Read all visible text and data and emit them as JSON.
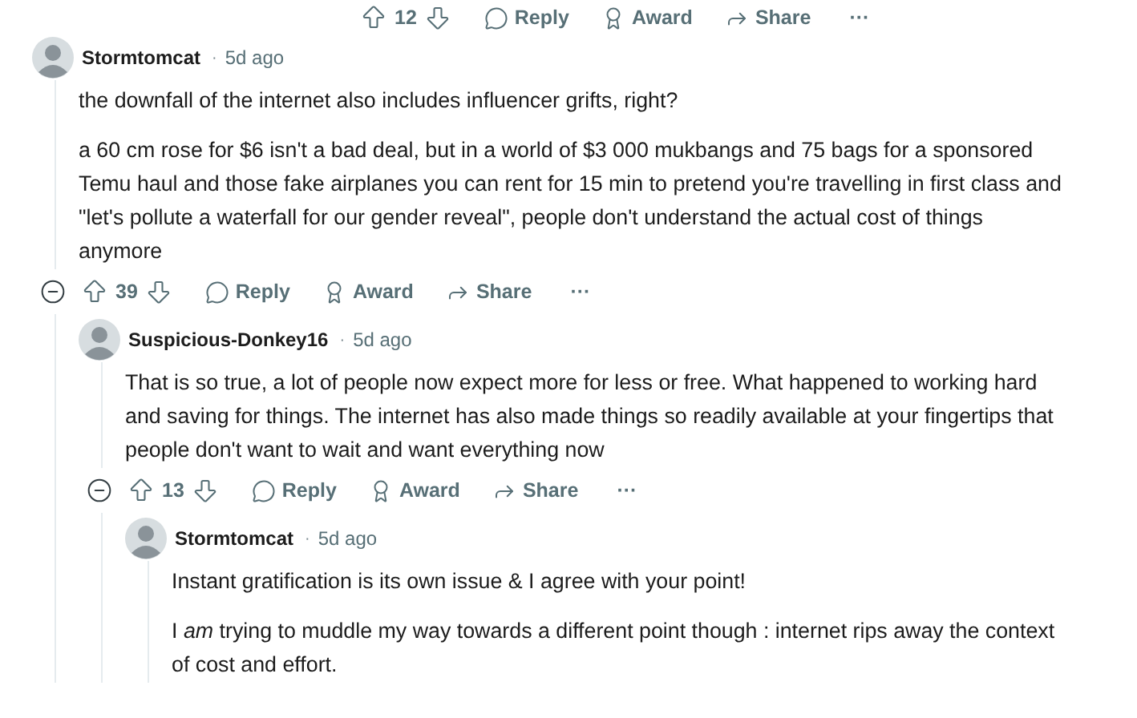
{
  "top_actions": {
    "votes": "12",
    "reply": "Reply",
    "award": "Award",
    "share": "Share",
    "more": "···"
  },
  "comments": [
    {
      "author": "Stormtomcat",
      "separator": "·",
      "time": "5d ago",
      "paragraphs": [
        "the downfall of the internet also includes influencer grifts, right?",
        "a 60 cm rose for $6 isn't a bad deal, but in a world of $3 000 mukbangs and 75 bags for a sponsored Temu haul and those fake airplanes you can rent for 15 min to pretend you're travelling in first class and \"let's pollute a waterfall for our gender reveal\", people don't understand the actual cost of things anymore"
      ],
      "actions": {
        "votes": "39",
        "reply": "Reply",
        "award": "Award",
        "share": "Share",
        "more": "···"
      },
      "children": [
        {
          "author": "Suspicious-Donkey16",
          "separator": "·",
          "time": "5d ago",
          "paragraphs": [
            "That is so true, a lot of people now expect more for less or free. What happened to working hard and saving for things. The internet has also made things so readily available at your fingertips that people don't want to wait and want everything now"
          ],
          "actions": {
            "votes": "13",
            "reply": "Reply",
            "award": "Award",
            "share": "Share",
            "more": "···"
          },
          "children": [
            {
              "author": "Stormtomcat",
              "separator": "·",
              "time": "5d ago",
              "paragraphs": [
                "Instant gratification is its own issue & I agree with your point!",
                "I *am* trying to muddle my way towards a different point though : internet rips away the context of cost and effort."
              ]
            }
          ]
        }
      ]
    }
  ]
}
